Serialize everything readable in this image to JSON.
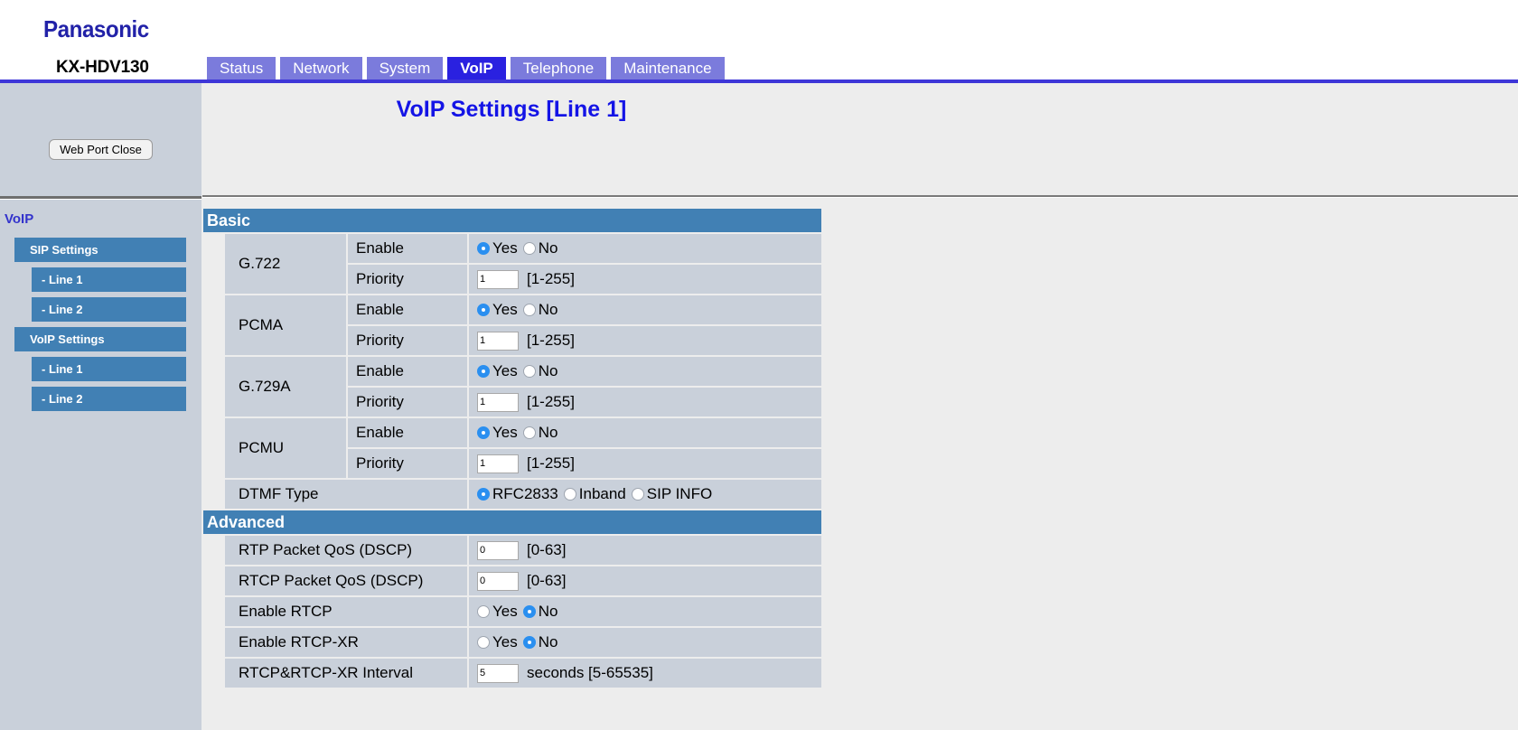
{
  "header": {
    "brand": "Panasonic",
    "model": "KX-HDV130"
  },
  "tabs": [
    {
      "label": "Status",
      "active": false
    },
    {
      "label": "Network",
      "active": false
    },
    {
      "label": "System",
      "active": false
    },
    {
      "label": "VoIP",
      "active": true
    },
    {
      "label": "Telephone",
      "active": false
    },
    {
      "label": "Maintenance",
      "active": false
    }
  ],
  "sidebar": {
    "web_port_button": "Web Port Close",
    "section_title": "VoIP",
    "items": [
      {
        "label": "SIP Settings",
        "level": 1
      },
      {
        "label": "- Line 1",
        "level": 2
      },
      {
        "label": "- Line 2",
        "level": 2
      },
      {
        "label": "VoIP Settings",
        "level": 1
      },
      {
        "label": "- Line 1",
        "level": 2
      },
      {
        "label": "- Line 2",
        "level": 2
      }
    ]
  },
  "main": {
    "page_title": "VoIP Settings [Line 1]",
    "sections": [
      {
        "title": "Basic",
        "codecs": [
          {
            "name": "G.722",
            "enable_label": "Enable",
            "enable_options": [
              {
                "label": "Yes",
                "selected": true
              },
              {
                "label": "No",
                "selected": false
              }
            ],
            "priority_label": "Priority",
            "priority_value": "1",
            "priority_hint": "[1-255]"
          },
          {
            "name": "PCMA",
            "enable_label": "Enable",
            "enable_options": [
              {
                "label": "Yes",
                "selected": true
              },
              {
                "label": "No",
                "selected": false
              }
            ],
            "priority_label": "Priority",
            "priority_value": "1",
            "priority_hint": "[1-255]"
          },
          {
            "name": "G.729A",
            "enable_label": "Enable",
            "enable_options": [
              {
                "label": "Yes",
                "selected": true
              },
              {
                "label": "No",
                "selected": false
              }
            ],
            "priority_label": "Priority",
            "priority_value": "1",
            "priority_hint": "[1-255]"
          },
          {
            "name": "PCMU",
            "enable_label": "Enable",
            "enable_options": [
              {
                "label": "Yes",
                "selected": true
              },
              {
                "label": "No",
                "selected": false
              }
            ],
            "priority_label": "Priority",
            "priority_value": "1",
            "priority_hint": "[1-255]"
          }
        ],
        "dtmf": {
          "label": "DTMF Type",
          "options": [
            {
              "label": "RFC2833",
              "selected": true
            },
            {
              "label": "Inband",
              "selected": false
            },
            {
              "label": "SIP INFO",
              "selected": false
            }
          ]
        }
      },
      {
        "title": "Advanced",
        "rows": [
          {
            "label": "RTP Packet QoS (DSCP)",
            "type": "text",
            "value": "0",
            "hint": "[0-63]"
          },
          {
            "label": "RTCP Packet QoS (DSCP)",
            "type": "text",
            "value": "0",
            "hint": "[0-63]"
          },
          {
            "label": "Enable RTCP",
            "type": "radio",
            "options": [
              {
                "label": "Yes",
                "selected": false
              },
              {
                "label": "No",
                "selected": true
              }
            ]
          },
          {
            "label": "Enable RTCP-XR",
            "type": "radio",
            "options": [
              {
                "label": "Yes",
                "selected": false
              },
              {
                "label": "No",
                "selected": true
              }
            ]
          },
          {
            "label": "RTCP&RTCP-XR Interval",
            "type": "text",
            "value": "5",
            "hint": "seconds [5-65535]"
          }
        ]
      }
    ]
  },
  "colors": {
    "tab_inactive": "#7B7BDC",
    "tab_active": "#2A21E0",
    "section_header": "#4180B4",
    "row_bg": "#C9D0DA",
    "sidebar_bg": "#C9D0DA",
    "radio_on": "#2A8FF0",
    "title_blue": "#1414E6",
    "brand_blue": "#2222A8"
  }
}
